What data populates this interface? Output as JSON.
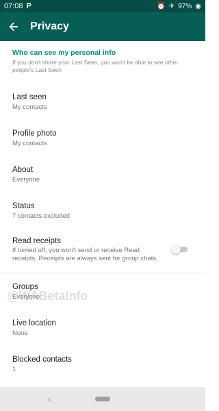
{
  "statusbar": {
    "time": "07:08",
    "p_label": "P",
    "battery": "97%"
  },
  "appbar": {
    "title": "Privacy"
  },
  "section": {
    "header": "Who can see my personal info",
    "description": "If you don't share your Last Seen, you won't be able to see other people's Last Seen"
  },
  "items": [
    {
      "label": "Last seen",
      "value": "My contacts"
    },
    {
      "label": "Profile photo",
      "value": "My contacts"
    },
    {
      "label": "About",
      "value": "Everyone"
    },
    {
      "label": "Status",
      "value": "7 contacts excluded"
    }
  ],
  "read_receipts": {
    "label": "Read receipts",
    "description": "If turned off, you won't send or receive Read receipts. Receipts are always sent for group chats.",
    "enabled": false
  },
  "items2": [
    {
      "label": "Groups",
      "value": "Everyone"
    },
    {
      "label": "Live location",
      "value": "None"
    },
    {
      "label": "Blocked contacts",
      "value": "1"
    }
  ],
  "watermark": "@WABetaInfo",
  "colors": {
    "statusbar": "#054d44",
    "appbar": "#075e54",
    "accent": "#00897b"
  }
}
